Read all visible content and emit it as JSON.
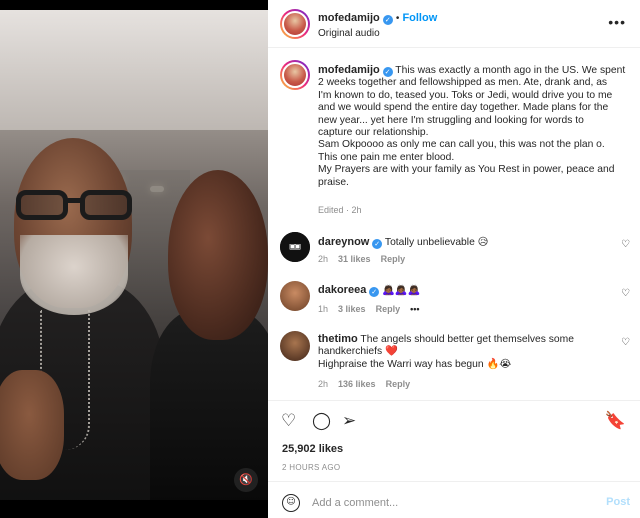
{
  "post": {
    "username": "mofedamijo",
    "audio": "Original audio",
    "separator": "•",
    "follow_label": "Follow",
    "more_icon": "more-icon",
    "caption_lines": [
      "This was exactly a month ago in the US. We spent",
      "2 weeks together and fellowshipped as men. Ate, drank and, as",
      "I'm known to do, teased you. Toks or Jedi, would drive you to me",
      "and we would spend the entire day together. Made plans for the",
      "new year... yet here I'm struggling and looking for words to",
      "capture our relationship.",
      "Sam Okpoooo as only me can call you, this was not the plan o.",
      "This one pain me enter blood.",
      "My Prayers are with your family as You Rest in power, peace and",
      "praise."
    ],
    "edited": "Edited · 2h"
  },
  "comments": [
    {
      "user": "dareynow",
      "verified": true,
      "text": "Totally unbelievable 😥",
      "time": "2h",
      "likes": "31 likes",
      "reply": "Reply",
      "extra": ""
    },
    {
      "user": "dakoreea",
      "verified": true,
      "text": "🙇🏾‍♀️🙇🏾‍♀️🙇🏾‍♀️",
      "time": "1h",
      "likes": "3 likes",
      "reply": "Reply",
      "extra": "•••"
    },
    {
      "user": "thetimo",
      "verified": false,
      "text_line1": "The angels should better get themselves some",
      "text_line2": "handkerchiefs ❤️",
      "text_line3": "Highpraise the Warri way has begun 🔥😭",
      "time": "2h",
      "likes": "136 likes",
      "reply": "Reply"
    }
  ],
  "actions": {
    "like_icon": "heart-icon",
    "comment_icon": "comment-icon",
    "share_icon": "share-icon",
    "save_icon": "bookmark-icon",
    "likes": "25,902 likes",
    "when": "2 HOURS AGO"
  },
  "add_comment": {
    "placeholder": "Add a comment...",
    "post_label": "Post",
    "emoji_icon": "emoji-icon"
  },
  "media": {
    "mute_icon": "mute-icon"
  },
  "colors": {
    "link": "#0095f6",
    "verified": "#3897f0",
    "muted_text": "#8e8e8e",
    "post_disabled": "#b2dffc"
  }
}
